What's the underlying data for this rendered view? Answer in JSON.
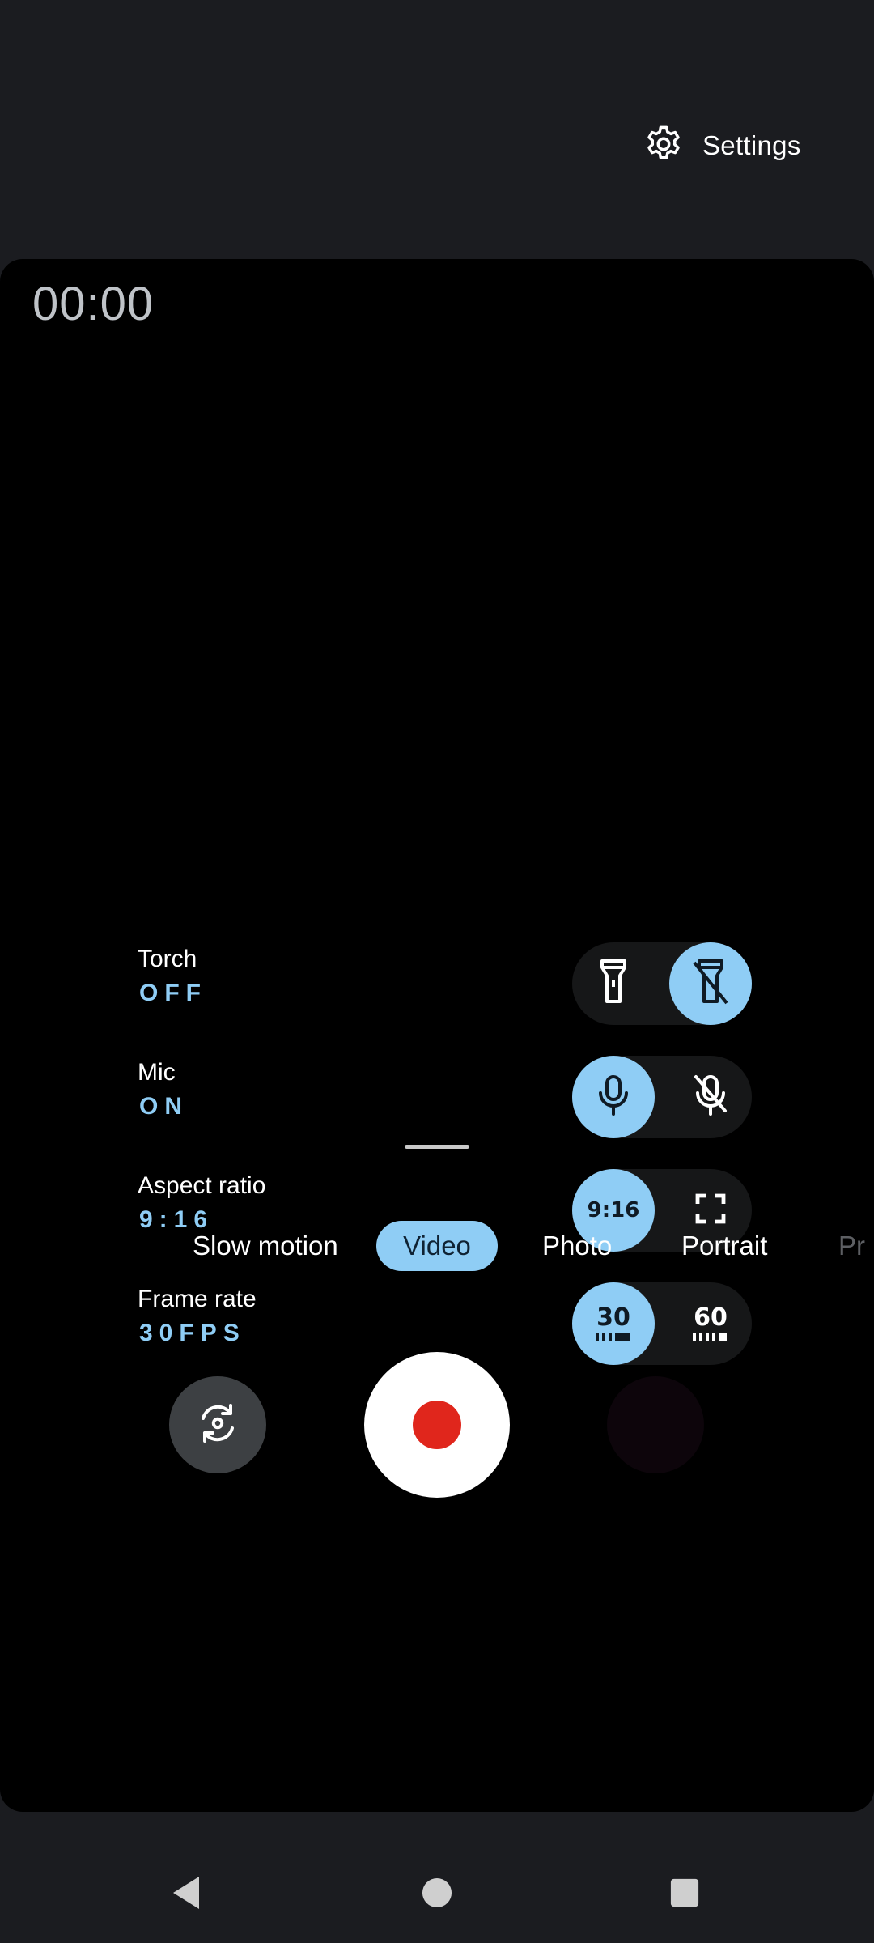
{
  "header": {
    "settings_label": "Settings"
  },
  "viewfinder": {
    "timer": "00:00"
  },
  "quick_settings": [
    {
      "title": "Torch",
      "value": "OFF",
      "options": [
        "torch-on",
        "torch-off"
      ],
      "active": "right"
    },
    {
      "title": "Mic",
      "value": "ON",
      "options": [
        "mic-on",
        "mic-off"
      ],
      "active": "left"
    },
    {
      "title": "Aspect ratio",
      "value": "9:16",
      "options": [
        "9:16",
        "full"
      ],
      "active": "left",
      "ratio_label": "9:16"
    },
    {
      "title": "Frame rate",
      "value": "30FPS",
      "options": [
        "30",
        "60"
      ],
      "active": "left",
      "fps_left": "30",
      "fps_right": "60"
    }
  ],
  "modes": [
    {
      "label": "Slow motion"
    },
    {
      "label": "Video",
      "active": true
    },
    {
      "label": "Photo"
    },
    {
      "label": "Portrait"
    },
    {
      "label": "Pr"
    }
  ],
  "colors": {
    "accent": "#8fcdf5",
    "record": "#e0261c",
    "background": "#1b1c20"
  }
}
